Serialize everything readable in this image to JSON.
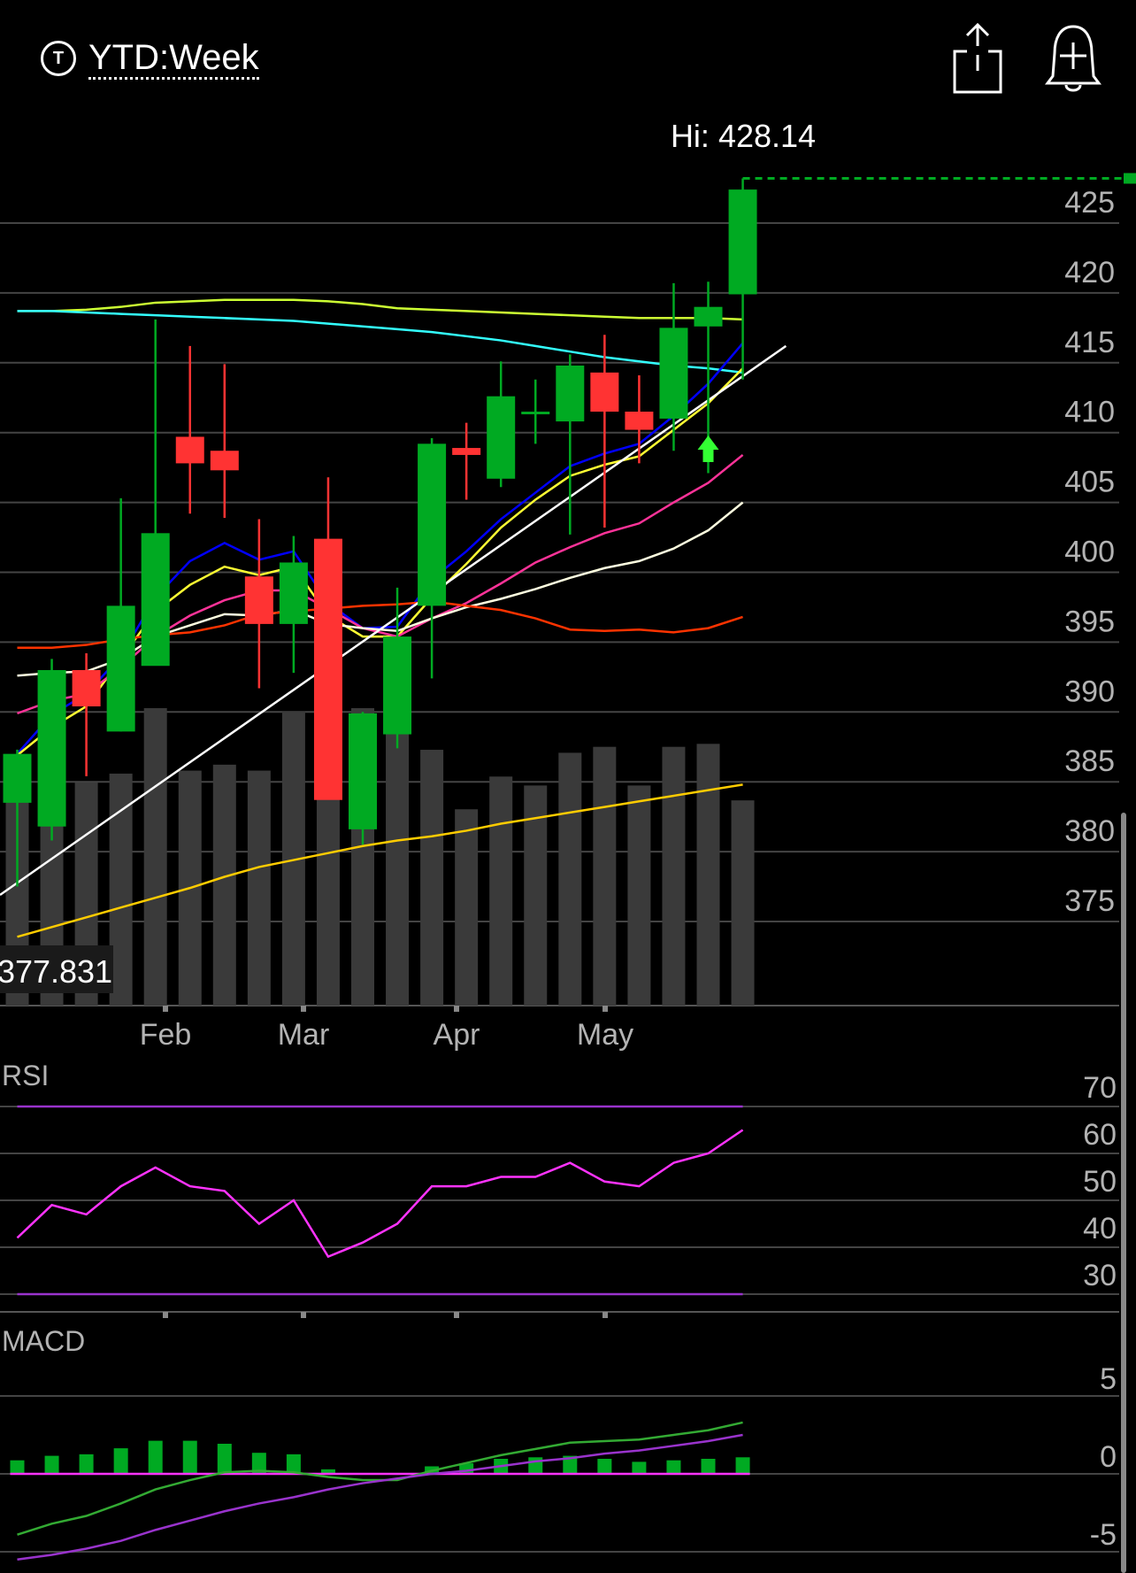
{
  "header": {
    "range_label": "YTD:Week",
    "t_icon_label": "T",
    "share_icon": "share-icon",
    "alert_icon": "bell-plus-icon"
  },
  "price_panel": {
    "hi_label": "Hi: 428.14",
    "hi_value": 428.14,
    "cursor_label": "377.831",
    "y_ticks": [
      425,
      420,
      415,
      410,
      405,
      400,
      395,
      390,
      385,
      380,
      375
    ]
  },
  "x_ticks": [
    "Feb",
    "Mar",
    "Apr",
    "May"
  ],
  "rsi_panel": {
    "label": "RSI",
    "y_ticks": [
      70,
      60,
      50,
      40,
      30
    ]
  },
  "macd_panel": {
    "label": "MACD",
    "y_ticks": [
      "5",
      "0",
      "-5"
    ]
  },
  "chart_data": {
    "type": "candlestick",
    "weeks": 22,
    "candles": [
      {
        "o": 383.5,
        "h": 387.3,
        "l": 377.5,
        "c": 387.0
      },
      {
        "o": 381.8,
        "h": 393.8,
        "l": 380.8,
        "c": 393.0
      },
      {
        "o": 393.0,
        "h": 394.2,
        "l": 385.4,
        "c": 390.4
      },
      {
        "o": 388.6,
        "h": 405.3,
        "l": 388.6,
        "c": 397.6
      },
      {
        "o": 393.3,
        "h": 418.1,
        "l": 397.6,
        "c": 402.8
      },
      {
        "o": 409.7,
        "h": 416.2,
        "l": 404.2,
        "c": 407.8
      },
      {
        "o": 408.7,
        "h": 414.9,
        "l": 403.9,
        "c": 407.3
      },
      {
        "o": 399.7,
        "h": 403.8,
        "l": 391.7,
        "c": 396.3
      },
      {
        "o": 396.3,
        "h": 402.6,
        "l": 392.8,
        "c": 400.7
      },
      {
        "o": 402.4,
        "h": 406.8,
        "l": 385.0,
        "c": 383.7
      },
      {
        "o": 381.6,
        "h": 390.0,
        "l": 380.5,
        "c": 389.9
      },
      {
        "o": 388.4,
        "h": 398.9,
        "l": 387.4,
        "c": 395.4
      },
      {
        "o": 397.6,
        "h": 409.6,
        "l": 392.4,
        "c": 409.2
      },
      {
        "o": 408.9,
        "h": 410.7,
        "l": 405.2,
        "c": 408.4
      },
      {
        "o": 406.7,
        "h": 415.1,
        "l": 406.1,
        "c": 412.6
      },
      {
        "o": 411.5,
        "h": 413.8,
        "l": 409.2,
        "c": 411.5
      },
      {
        "o": 410.8,
        "h": 415.6,
        "l": 402.7,
        "c": 414.8
      },
      {
        "o": 414.3,
        "h": 417.0,
        "l": 403.2,
        "c": 411.5
      },
      {
        "o": 411.5,
        "h": 414.1,
        "l": 407.8,
        "c": 410.2
      },
      {
        "o": 411.0,
        "h": 420.7,
        "l": 408.7,
        "c": 417.5
      },
      {
        "o": 417.6,
        "h": 420.8,
        "l": 407.1,
        "c": 419.0
      },
      {
        "o": 419.9,
        "h": 428.2,
        "l": 413.8,
        "c": 427.4
      }
    ],
    "volume_relative": [
      0.71,
      0.8,
      0.75,
      0.78,
      1.0,
      0.79,
      0.81,
      0.79,
      0.99,
      1.0,
      1.0,
      1.0,
      0.86,
      0.66,
      0.77,
      0.74,
      0.85,
      0.87,
      0.74,
      0.87,
      0.88,
      0.69
    ],
    "moving_averages": [
      {
        "color": "#ccff33",
        "values": [
          418.7,
          418.7,
          418.8,
          419.0,
          419.3,
          419.4,
          419.5,
          419.5,
          419.5,
          419.4,
          419.2,
          418.9,
          418.8,
          418.7,
          418.6,
          418.5,
          418.4,
          418.3,
          418.2,
          418.2,
          418.2,
          418.1
        ]
      },
      {
        "color": "#33ffff",
        "values": [
          418.7,
          418.7,
          418.6,
          418.5,
          418.4,
          418.3,
          418.2,
          418.1,
          418.0,
          417.8,
          417.6,
          417.4,
          417.2,
          416.9,
          416.6,
          416.2,
          415.8,
          415.4,
          415.1,
          414.8,
          414.6,
          414.3
        ]
      },
      {
        "color": "#0000ff",
        "values": [
          387.0,
          389.8,
          391.3,
          394.0,
          398.2,
          400.8,
          402.1,
          400.9,
          401.5,
          397.8,
          396.0,
          396.1,
          399.5,
          401.5,
          403.8,
          405.7,
          407.6,
          408.5,
          409.2,
          411.2,
          413.5,
          416.4
        ]
      },
      {
        "color": "#ffff33",
        "values": [
          386.9,
          388.9,
          390.4,
          393.8,
          397.2,
          399.1,
          400.4,
          399.8,
          400.4,
          396.9,
          395.4,
          395.4,
          398.2,
          400.6,
          403.2,
          405.2,
          406.9,
          407.7,
          408.3,
          410.2,
          412.1,
          414.6
        ]
      },
      {
        "color": "#ff3399",
        "values": [
          389.9,
          390.8,
          391.3,
          393.2,
          395.4,
          396.9,
          398.0,
          398.7,
          398.7,
          397.4,
          396.0,
          395.4,
          396.7,
          397.8,
          399.2,
          400.7,
          401.8,
          402.8,
          403.5,
          405.0,
          406.4,
          408.4
        ]
      },
      {
        "color": "#ffffe0",
        "values": [
          392.6,
          392.8,
          392.9,
          393.8,
          395.4,
          396.2,
          397.0,
          396.9,
          397.3,
          396.3,
          396.0,
          395.8,
          396.7,
          397.5,
          398.1,
          398.8,
          399.6,
          400.3,
          400.8,
          401.7,
          403.0,
          405.0
        ]
      },
      {
        "color": "#ff3300",
        "values": [
          394.6,
          394.6,
          394.8,
          395.2,
          395.5,
          395.7,
          396.2,
          397.0,
          397.2,
          397.4,
          397.6,
          397.7,
          397.9,
          397.6,
          397.3,
          396.7,
          395.9,
          395.8,
          395.9,
          395.7,
          396.0,
          396.8
        ]
      },
      {
        "color": "#ffcc00",
        "values": [
          373.9,
          374.6,
          375.3,
          376.0,
          376.7,
          377.4,
          378.2,
          378.9,
          379.4,
          379.9,
          380.4,
          380.8,
          381.1,
          381.5,
          382.0,
          382.4,
          382.8,
          383.2,
          383.6,
          384.0,
          384.4,
          384.8
        ]
      }
    ],
    "trendline": {
      "color": "#ffffff",
      "from": {
        "week": -0.5,
        "value": 376.9
      },
      "to": {
        "week": 22.25,
        "value": 416.2
      }
    },
    "signal_arrow_week": 20,
    "rsi": {
      "overbought": 70,
      "oversold": 30,
      "values": [
        42,
        49,
        47,
        53,
        57,
        53,
        52,
        45,
        50,
        38,
        41,
        45,
        53,
        53,
        55,
        55,
        58,
        54,
        53,
        58,
        60,
        65
      ]
    },
    "macd": {
      "histogram": [
        0.45,
        0.6,
        0.65,
        0.85,
        1.1,
        1.1,
        1.0,
        0.7,
        0.65,
        0.15,
        0.0,
        0.0,
        0.25,
        0.35,
        0.5,
        0.55,
        0.6,
        0.5,
        0.4,
        0.45,
        0.5,
        0.55
      ],
      "macd_line": [
        -3.9,
        -3.2,
        -2.7,
        -1.9,
        -1.0,
        -0.4,
        0.1,
        0.2,
        0.1,
        -0.2,
        -0.4,
        -0.4,
        0.2,
        0.7,
        1.2,
        1.6,
        2.0,
        2.1,
        2.2,
        2.5,
        2.8,
        3.3
      ],
      "signal_line": [
        -5.5,
        -5.2,
        -4.8,
        -4.3,
        -3.6,
        -3.0,
        -2.4,
        -1.9,
        -1.5,
        -1.0,
        -0.6,
        -0.3,
        0.0,
        0.2,
        0.5,
        0.8,
        1.0,
        1.3,
        1.5,
        1.8,
        2.1,
        2.5
      ],
      "macd_color": "#33aa33",
      "signal_color": "#9933cc"
    }
  },
  "colors": {
    "up": "#00aa22",
    "down": "#ff3333",
    "grid": "#444444",
    "axis_text": "#b3b3b3",
    "volume": "#3a3a3a",
    "arrow": "#33ff33"
  }
}
